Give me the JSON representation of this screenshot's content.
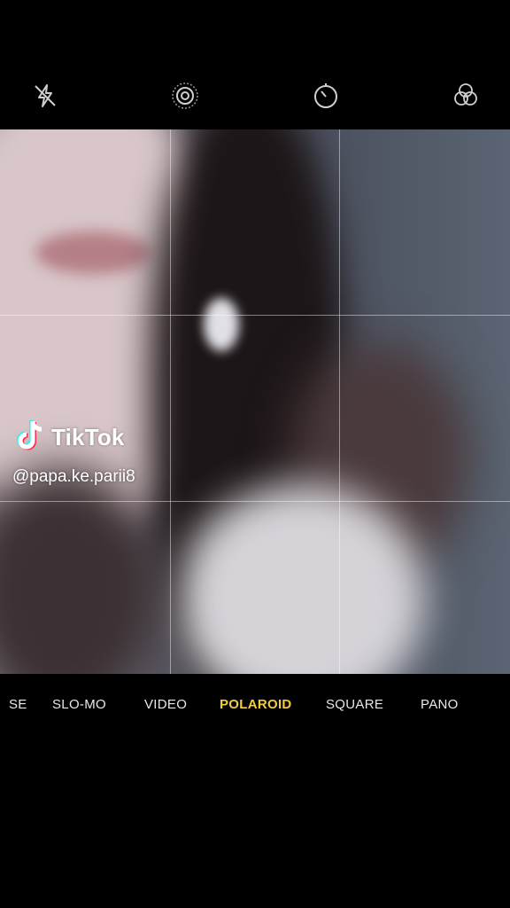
{
  "topbar": {
    "icons": [
      "flash-off-icon",
      "live-photo-icon",
      "timer-icon",
      "filters-icon"
    ]
  },
  "watermark": {
    "brand": "TikTok",
    "handle": "@papa.ke.parii8"
  },
  "modes": {
    "items": [
      "SE",
      "SLO-MO",
      "VIDEO",
      "POLAROID",
      "SQUARE",
      "PANO"
    ],
    "active": "POLAROID",
    "active_color": "#f2cc3d"
  }
}
